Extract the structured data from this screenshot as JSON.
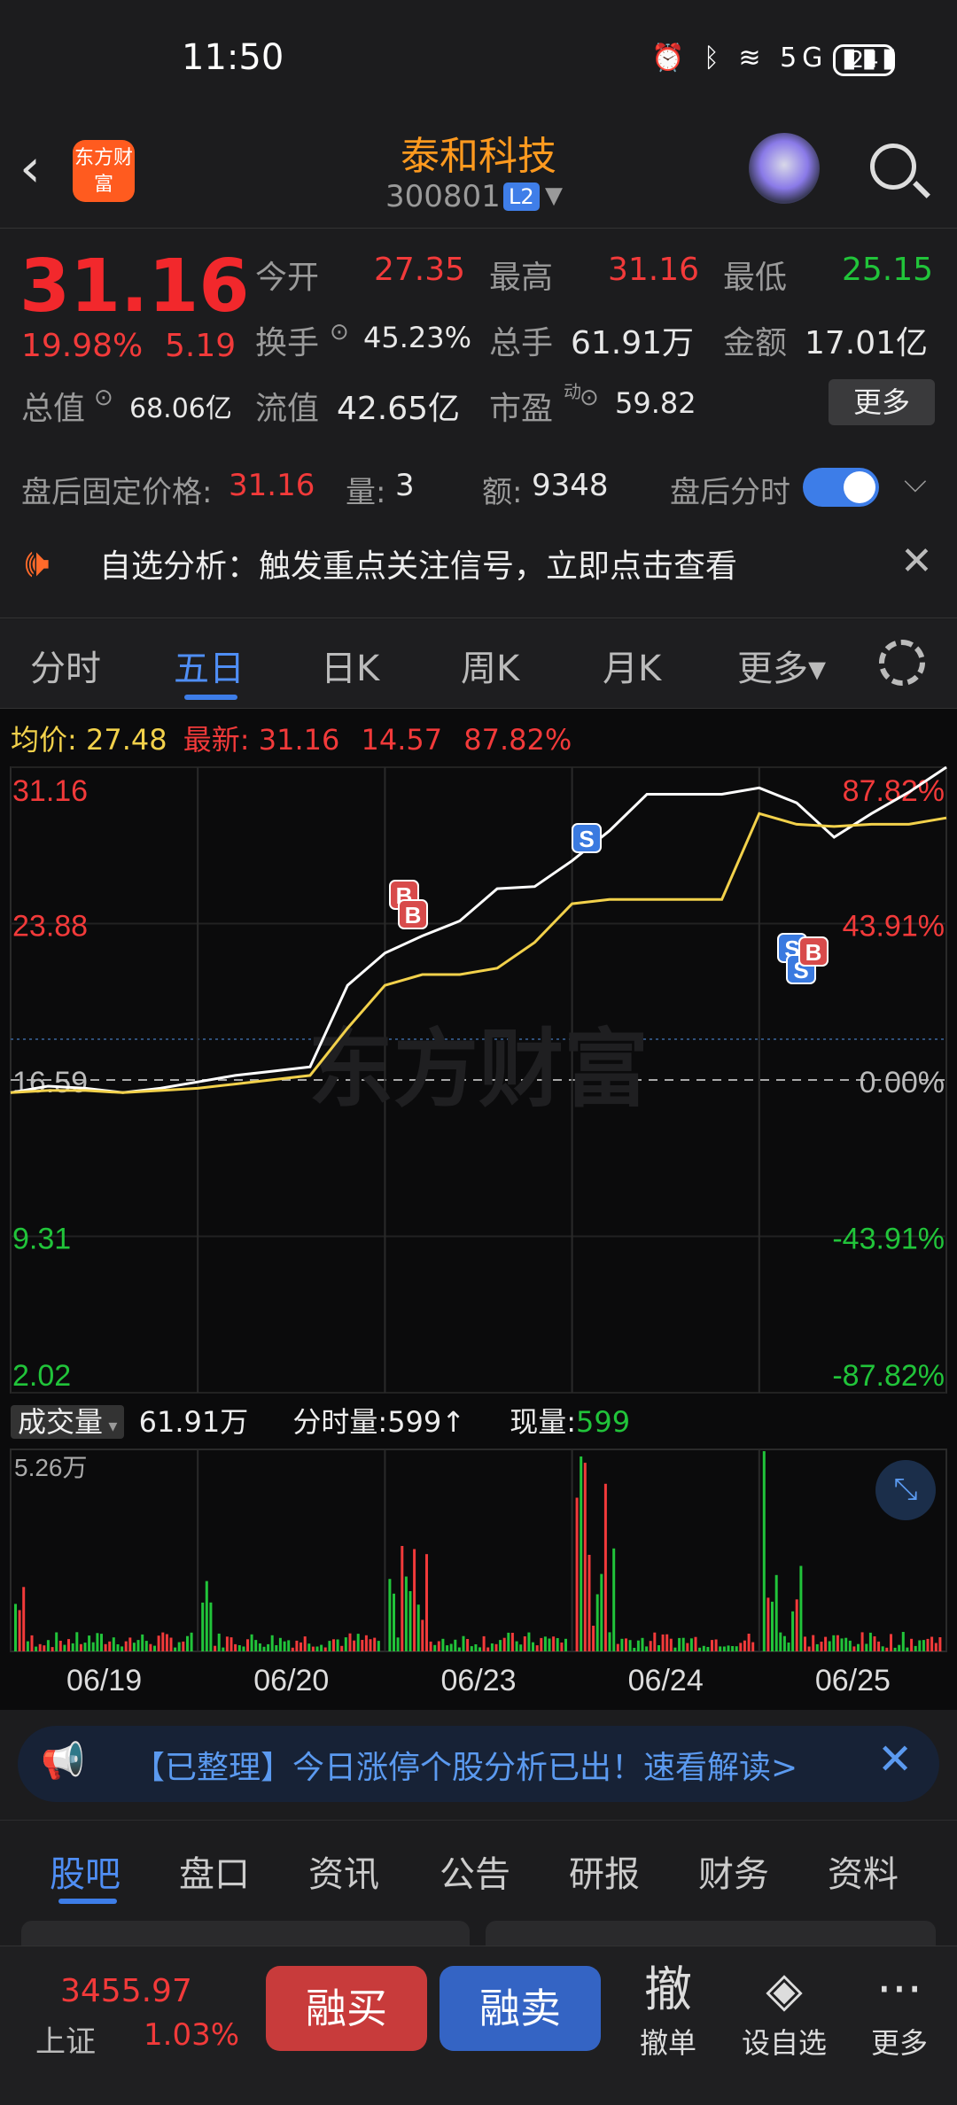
{
  "status_bar": {
    "time": "11:50",
    "icons": "⏰ ᛒ ≋ 5G ▮▮▮",
    "battery": "24"
  },
  "header": {
    "back_icon": "chevron-left",
    "logo_text": "东方财富",
    "title": "泰和科技",
    "code": "300801",
    "badge": "L2"
  },
  "quote": {
    "price": "31.16",
    "change_pct": "19.98%",
    "change": "5.19",
    "open_label": "今开",
    "open": "27.35",
    "high_label": "最高",
    "high": "31.16",
    "low_label": "最低",
    "low": "25.15",
    "turnover_label": "换手",
    "turnover": "45.23%",
    "volume_label": "总手",
    "volume": "61.91万",
    "amount_label": "金额",
    "amount": "17.01亿",
    "mktcap_label": "总值",
    "mktcap": "68.06亿",
    "float_label": "流值",
    "float_cap": "42.65亿",
    "pe_label": "市盈",
    "pe_sup": "动",
    "pe": "59.82",
    "more": "更多"
  },
  "after_hours": {
    "price_label": "盘后固定价格:",
    "price": "31.16",
    "vol_label": "量:",
    "vol": "3",
    "amt_label": "额:",
    "amt": "9348",
    "toggle_label": "盘后分时",
    "toggle_on": true
  },
  "alert": {
    "text": "自选分析：触发重点关注信号，立即点击查看"
  },
  "chart_tabs": [
    "分时",
    "五日",
    "日K",
    "周K",
    "月K",
    "更多▾"
  ],
  "chart_tab_active": 1,
  "chart_info": {
    "avg_label": "均价:",
    "avg": "27.48",
    "latest_label": "最新:",
    "latest": "31.16",
    "change": "14.57",
    "pct": "87.82%"
  },
  "chart_data": {
    "type": "line",
    "days": [
      "06/19",
      "06/20",
      "06/23",
      "06/24",
      "06/25"
    ],
    "y_left_ticks": [
      "31.16",
      "23.88",
      "16.59",
      "9.31",
      "2.02"
    ],
    "y_right_ticks": [
      "87.82%",
      "43.91%",
      "0.00%",
      "-43.91%",
      "-87.82%"
    ],
    "ylim": [
      2.02,
      31.16
    ],
    "prev_close": 16.59,
    "series": [
      {
        "values": [
          16.0,
          16.3,
          16.2,
          16.0,
          16.2,
          16.5,
          16.8,
          17.0,
          17.2,
          21.0,
          22.5,
          23.3,
          24.0,
          25.5,
          25.6,
          26.8,
          28.2,
          29.9,
          29.9,
          29.9,
          30.2,
          29.5,
          27.9,
          29.0,
          30.0,
          31.16
        ]
      },
      {
        "values": [
          16.0,
          16.1,
          16.1,
          16.0,
          16.1,
          16.2,
          16.4,
          16.6,
          16.8,
          19.0,
          21.0,
          21.5,
          21.5,
          21.8,
          23.0,
          24.8,
          25.0,
          25.0,
          25.0,
          25.0,
          29.0,
          28.5,
          28.4,
          28.5,
          28.5,
          28.8
        ]
      }
    ],
    "volume_max_label": "5.26万"
  },
  "signals": [
    {
      "label": "B"
    },
    {
      "label": "B"
    },
    {
      "label": "S"
    },
    {
      "label": "S"
    },
    {
      "label": "S"
    },
    {
      "label": "B"
    }
  ],
  "volume_header": {
    "select": "成交量",
    "total": "61.91万",
    "tick_label": "分时量:",
    "tick": "599",
    "arrow": "↑",
    "now_label": "现量:",
    "now": "599"
  },
  "banner": {
    "text": "【已整理】今日涨停个股分析已出！速看解读>"
  },
  "bottom_tabs": [
    "股吧",
    "盘口",
    "资讯",
    "公告",
    "研报",
    "财务",
    "资料"
  ],
  "bottom_tab_active": 0,
  "footer": {
    "index_value": "3455.97",
    "index_name": "上证",
    "index_pct": "1.03%",
    "buy": "融买",
    "sell": "融卖",
    "cancel_icon": "撤",
    "cancel": "撤单",
    "watch": "设自选",
    "more": "更多"
  },
  "colors": {
    "up": "#f23a3a",
    "down": "#21c43a",
    "accent": "#3d7de8",
    "price_line": "#ffffff",
    "avg_line": "#f2d14b"
  }
}
